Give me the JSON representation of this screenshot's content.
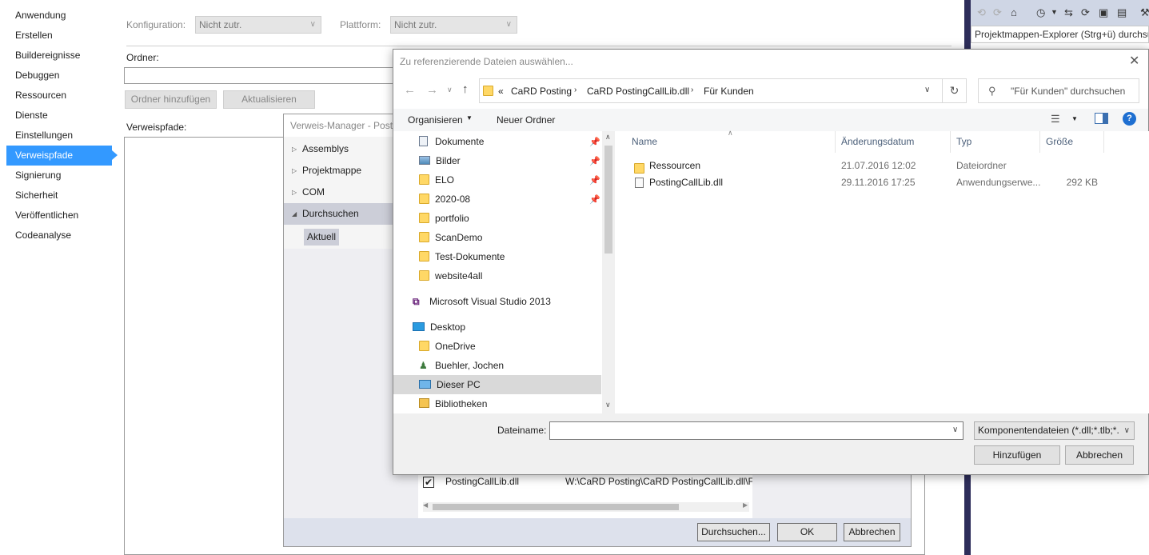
{
  "vs_nav": {
    "items": [
      "Anwendung",
      "Erstellen",
      "Buildereignisse",
      "Debuggen",
      "Ressourcen",
      "Dienste",
      "Einstellungen",
      "Verweispfade",
      "Signierung",
      "Sicherheit",
      "Veröffentlichen",
      "Codeanalyse"
    ],
    "selected": "Verweispfade"
  },
  "props": {
    "config_label": "Konfiguration:",
    "config_value": "Nicht zutr.",
    "platform_label": "Plattform:",
    "platform_value": "Nicht zutr.",
    "folder_label": "Ordner:",
    "add_folder": "Ordner hinzufügen",
    "refresh": "Aktualisieren",
    "refpaths_label": "Verweispfade:"
  },
  "solution_explorer": {
    "search_placeholder": "Projektmappen-Explorer (Strg+ü) durchsu"
  },
  "ref_manager": {
    "title": "Verweis-Manager - Posti",
    "tree": [
      "Assemblys",
      "Projektmappe",
      "COM",
      "Durchsuchen"
    ],
    "current": "Aktuell",
    "row_file": "PostingCallLib.dll",
    "row_path": "W:\\CaRD Posting\\CaRD PostingCallLib.dll\\Fü",
    "browse": "Durchsuchen...",
    "ok": "OK",
    "cancel": "Abbrechen"
  },
  "file_dialog": {
    "title": "Zu referenzierende Dateien auswählen...",
    "breadcrumb": [
      "«",
      "CaRD Posting",
      "CaRD PostingCallLib.dll",
      "Für Kunden"
    ],
    "search_placeholder": "\"Für Kunden\" durchsuchen",
    "organize": "Organisieren",
    "new_folder": "Neuer Ordner",
    "tree": [
      {
        "label": "Dokumente",
        "icon": "documents-icon",
        "pinned": true
      },
      {
        "label": "Bilder",
        "icon": "pictures-icon",
        "pinned": true
      },
      {
        "label": "ELO",
        "icon": "folder-icon",
        "pinned": true
      },
      {
        "label": "2020-08",
        "icon": "folder-icon",
        "pinned": true
      },
      {
        "label": "portfolio",
        "icon": "folder-icon",
        "pinned": false
      },
      {
        "label": "ScanDemo",
        "icon": "folder-icon",
        "pinned": false
      },
      {
        "label": "Test-Dokumente",
        "icon": "folder-icon",
        "pinned": false
      },
      {
        "label": "website4all",
        "icon": "folder-icon",
        "pinned": false
      },
      {
        "label": "Microsoft Visual Studio 2013",
        "icon": "visual-studio-icon",
        "pinned": false
      },
      {
        "label": "Desktop",
        "icon": "desktop-icon",
        "pinned": false
      },
      {
        "label": "OneDrive",
        "icon": "folder-icon",
        "pinned": false
      },
      {
        "label": "Buehler, Jochen",
        "icon": "user-icon",
        "pinned": false
      },
      {
        "label": "Dieser PC",
        "icon": "computer-icon",
        "pinned": false
      },
      {
        "label": "Bibliotheken",
        "icon": "libraries-icon",
        "pinned": false
      }
    ],
    "columns": [
      "Name",
      "Änderungsdatum",
      "Typ",
      "Größe"
    ],
    "files": [
      {
        "name": "Ressourcen",
        "date": "21.07.2016 12:02",
        "type": "Dateiordner",
        "size": ""
      },
      {
        "name": "PostingCallLib.dll",
        "date": "29.11.2016 17:25",
        "type": "Anwendungserwe...",
        "size": "292 KB"
      }
    ],
    "filename_label": "Dateiname:",
    "filename_value": "",
    "filter": "Komponentendateien (*.dll;*.tlb;*.",
    "add": "Hinzufügen",
    "cancel": "Abbrechen"
  }
}
